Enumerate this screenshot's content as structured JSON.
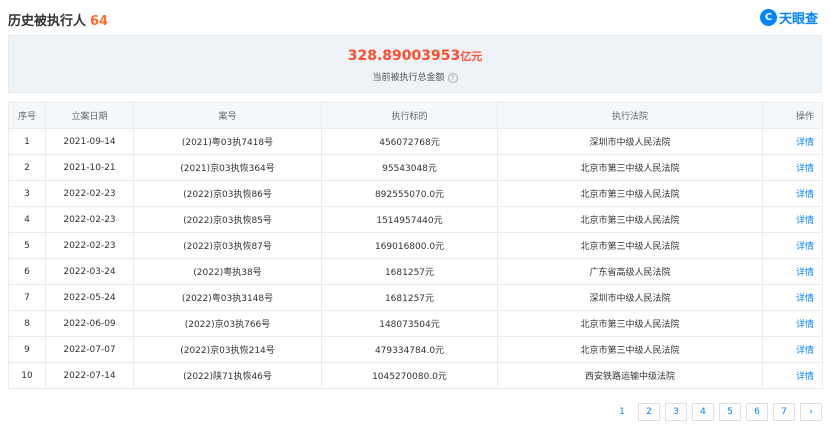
{
  "header": {
    "title": "历史被执行人",
    "count": "64",
    "brand_logo": "C",
    "brand_text": "天眼查"
  },
  "summary": {
    "amount": "328.89003953",
    "unit": "亿元",
    "label": "当前被执行总金额",
    "help_icon": "?"
  },
  "table": {
    "columns": [
      "序号",
      "立案日期",
      "案号",
      "执行标的",
      "执行法院",
      "操作"
    ],
    "rows": [
      {
        "no": "1",
        "date": "2021-09-14",
        "case": "(2021)粤03执7418号",
        "amount": "456072768元",
        "court": "深圳市中级人民法院",
        "action": "详情"
      },
      {
        "no": "2",
        "date": "2021-10-21",
        "case": "(2021)京03执恢364号",
        "amount": "95543048元",
        "court": "北京市第三中级人民法院",
        "action": "详情"
      },
      {
        "no": "3",
        "date": "2022-02-23",
        "case": "(2022)京03执恢86号",
        "amount": "892555070.0元",
        "court": "北京市第三中级人民法院",
        "action": "详情"
      },
      {
        "no": "4",
        "date": "2022-02-23",
        "case": "(2022)京03执恢85号",
        "amount": "1514957440元",
        "court": "北京市第三中级人民法院",
        "action": "详情"
      },
      {
        "no": "5",
        "date": "2022-02-23",
        "case": "(2022)京03执恢87号",
        "amount": "169016800.0元",
        "court": "北京市第三中级人民法院",
        "action": "详情"
      },
      {
        "no": "6",
        "date": "2022-03-24",
        "case": "(2022)粤执38号",
        "amount": "1681257元",
        "court": "广东省高级人民法院",
        "action": "详情"
      },
      {
        "no": "7",
        "date": "2022-05-24",
        "case": "(2022)粤03执3148号",
        "amount": "1681257元",
        "court": "深圳市中级人民法院",
        "action": "详情"
      },
      {
        "no": "8",
        "date": "2022-06-09",
        "case": "(2022)京03执766号",
        "amount": "148073504元",
        "court": "北京市第三中级人民法院",
        "action": "详情"
      },
      {
        "no": "9",
        "date": "2022-07-07",
        "case": "(2022)京03执恢214号",
        "amount": "479334784.0元",
        "court": "北京市第三中级人民法院",
        "action": "详情"
      },
      {
        "no": "10",
        "date": "2022-07-14",
        "case": "(2022)陕71执恢46号",
        "amount": "1045270080.0元",
        "court": "西安铁路运输中级法院",
        "action": "详情"
      }
    ]
  },
  "pagination": {
    "pages": [
      "1",
      "2",
      "3",
      "4",
      "5",
      "6",
      "7"
    ],
    "current": "1",
    "next_icon": "›"
  },
  "colors": {
    "accent": "#0084ff",
    "amount": "#ff4d2e",
    "count": "#ff6b2c"
  }
}
